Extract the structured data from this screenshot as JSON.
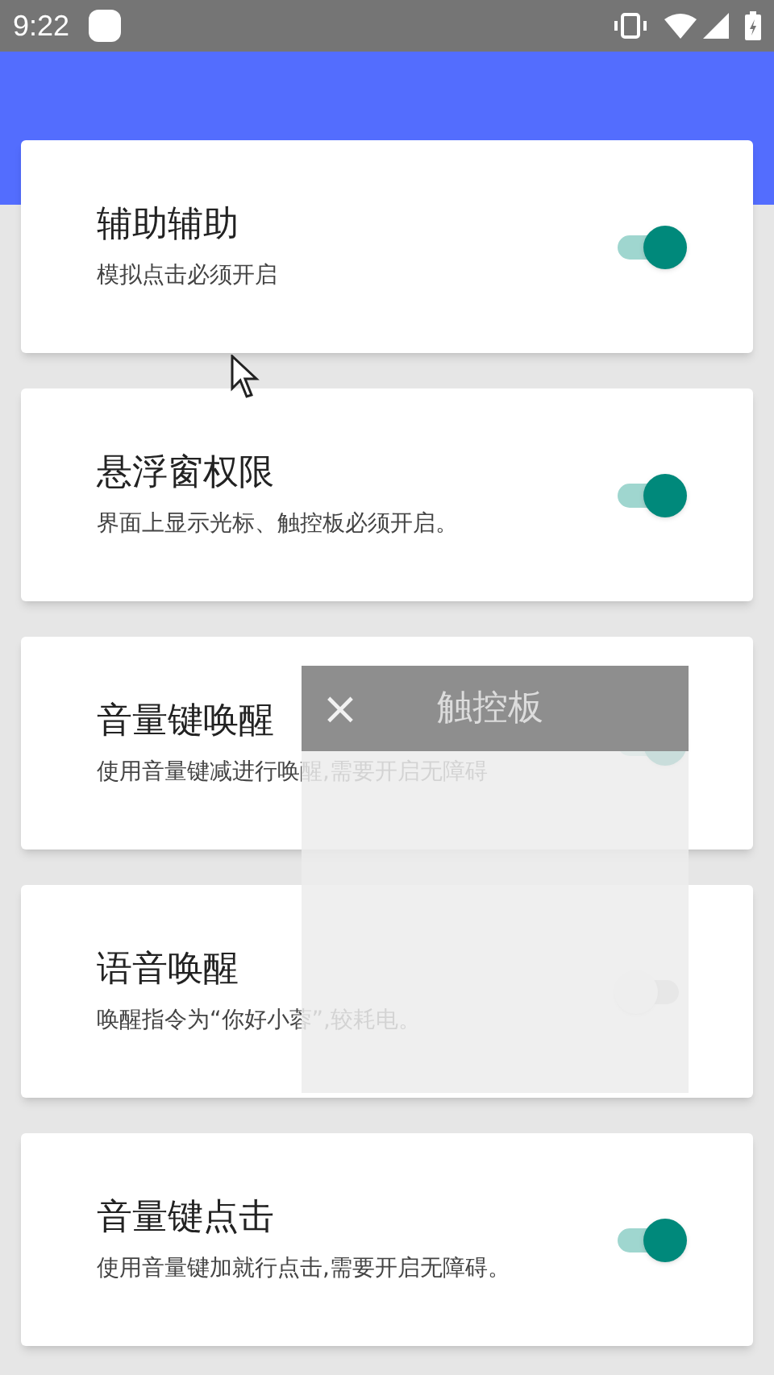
{
  "status_bar": {
    "time": "9:22"
  },
  "settings": [
    {
      "title": "辅助辅助",
      "subtitle": "模拟点击必须开启",
      "on": true
    },
    {
      "title": "悬浮窗权限",
      "subtitle": "界面上显示光标、触控板必须开启。",
      "on": true
    },
    {
      "title": "音量键唤醒",
      "subtitle": "使用音量键减进行唤醒,需要开启无障碍",
      "on": true
    },
    {
      "title": "语音唤醒",
      "subtitle": "唤醒指令为“你好小蓉”,较耗电。",
      "on": false
    },
    {
      "title": "音量键点击",
      "subtitle": "使用音量键加就行点击,需要开启无障碍。",
      "on": true
    }
  ],
  "touchpad_panel": {
    "close": "×",
    "title": "触控板"
  }
}
